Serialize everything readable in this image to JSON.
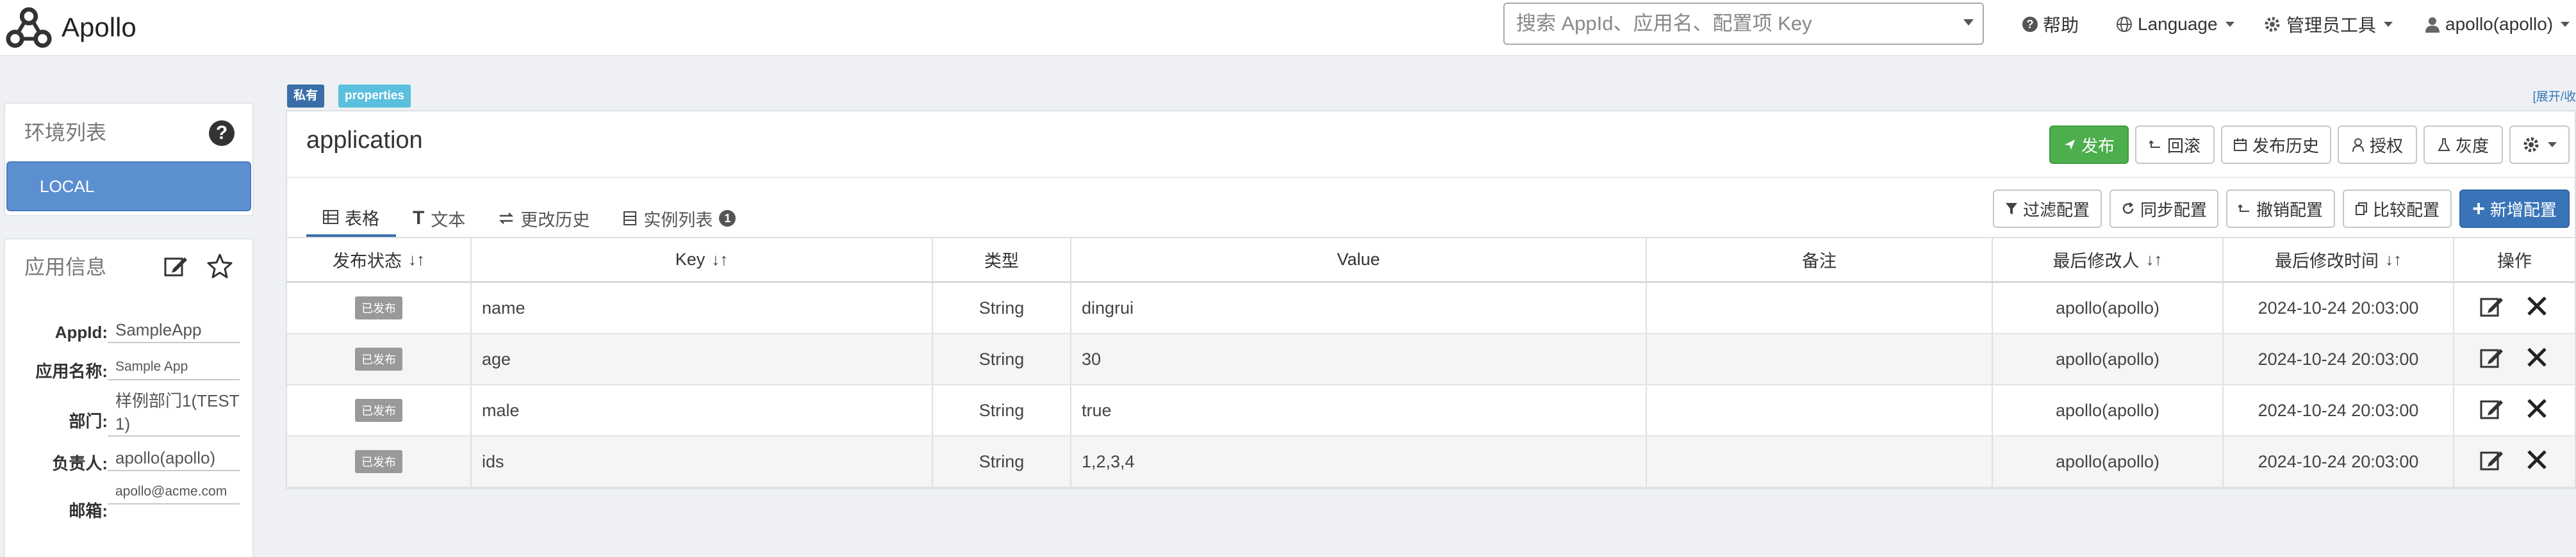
{
  "navbar": {
    "brand": "Apollo",
    "search_placeholder": "搜索 AppId、应用名、配置项 Key",
    "help": "帮助",
    "language": "Language",
    "admin_tools": "管理员工具",
    "user": "apollo(apollo)"
  },
  "sidebar": {
    "env_title": "环境列表",
    "env_items": [
      "LOCAL"
    ],
    "app_title": "应用信息",
    "app_info": [
      {
        "label": "AppId:",
        "value": "SampleApp"
      },
      {
        "label": "应用名称:",
        "value": "Sample App"
      },
      {
        "label": "部门:",
        "value": "样例部门1(TEST1)"
      },
      {
        "label": "负责人:",
        "value": "apollo(apollo)"
      },
      {
        "label": "邮箱:",
        "value": "apollo@acme.com"
      }
    ]
  },
  "namespace": {
    "tag_private": "私有",
    "tag_format": "properties",
    "expand_toggle": "[展开/收",
    "name": "application",
    "actions": {
      "publish": "发布",
      "rollback": "回滚",
      "publish_history": "发布历史",
      "authorize": "授权",
      "gray": "灰度"
    },
    "tabs": [
      "表格",
      "文本",
      "更改历史",
      "实例列表"
    ],
    "instance_count": "1",
    "table_actions": {
      "filter": "过滤配置",
      "sync": "同步配置",
      "revoke": "撤销配置",
      "compare": "比较配置",
      "add": "新增配置"
    },
    "columns": [
      "发布状态",
      "Key",
      "类型",
      "Value",
      "备注",
      "最后修改人",
      "最后修改时间",
      "操作"
    ],
    "rows": [
      {
        "status": "已发布",
        "key": "name",
        "type": "String",
        "value": "dingrui",
        "comment": "",
        "modifier": "apollo(apollo)",
        "time": "2024-10-24 20:03:00"
      },
      {
        "status": "已发布",
        "key": "age",
        "type": "String",
        "value": "30",
        "comment": "",
        "modifier": "apollo(apollo)",
        "time": "2024-10-24 20:03:00"
      },
      {
        "status": "已发布",
        "key": "male",
        "type": "String",
        "value": "true",
        "comment": "",
        "modifier": "apollo(apollo)",
        "time": "2024-10-24 20:03:00"
      },
      {
        "status": "已发布",
        "key": "ids",
        "type": "String",
        "value": "1,2,3,4",
        "comment": "",
        "modifier": "apollo(apollo)",
        "time": "2024-10-24 20:03:00"
      }
    ]
  },
  "colors": {
    "primary_blue": "#3a74b8",
    "env_active": "#5b8fd0",
    "publish_green": "#4cae4c",
    "tag_private": "#3a6ea8",
    "tag_format": "#5bc0de",
    "status_badge": "#999999"
  },
  "icons": [
    "apollo-logo-icon",
    "question-circle-icon",
    "globe-icon",
    "gear-icon",
    "user-icon",
    "edit-icon",
    "star-icon",
    "send-icon",
    "undo-icon",
    "calendar-icon",
    "person-icon",
    "flask-icon",
    "list-icon",
    "text-icon",
    "exchange-icon",
    "server-icon",
    "filter-icon",
    "refresh-icon",
    "revoke-icon",
    "copy-icon",
    "plus-icon",
    "sort-icon",
    "close-icon"
  ]
}
